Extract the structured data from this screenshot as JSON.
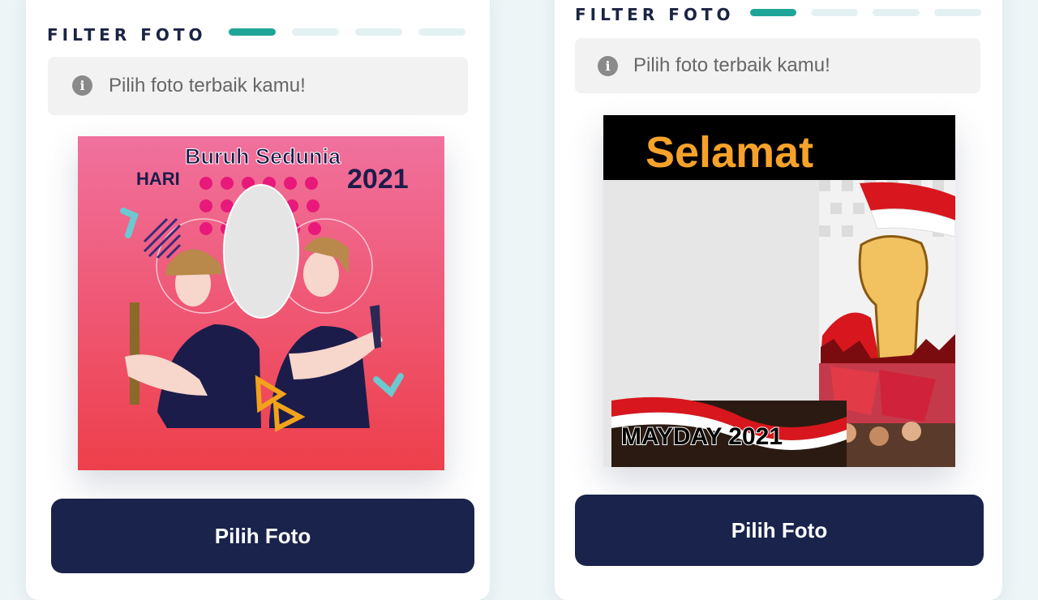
{
  "left_card": {
    "title": "FILTER FOTO",
    "info_text": "Pilih foto terbaik kamu!",
    "info_icon": "info-icon",
    "button_label": "Pilih Foto",
    "frame": {
      "hari": "HARI",
      "headline": "Buruh Sedunia",
      "year": "2021"
    }
  },
  "right_card": {
    "title": "FILTER FOTO",
    "info_text": "Pilih foto terbaik kamu!",
    "info_icon": "info-icon",
    "button_label": "Pilih Foto",
    "frame": {
      "headline": "Selamat",
      "banner": "MAYDAY 2021"
    }
  },
  "colors": {
    "accent": "#1fa597",
    "step_inactive": "#e4f1f3",
    "button": "#19234b",
    "pink_frame_top": "#f0719e",
    "pink_frame_bottom": "#ee3f4b"
  }
}
